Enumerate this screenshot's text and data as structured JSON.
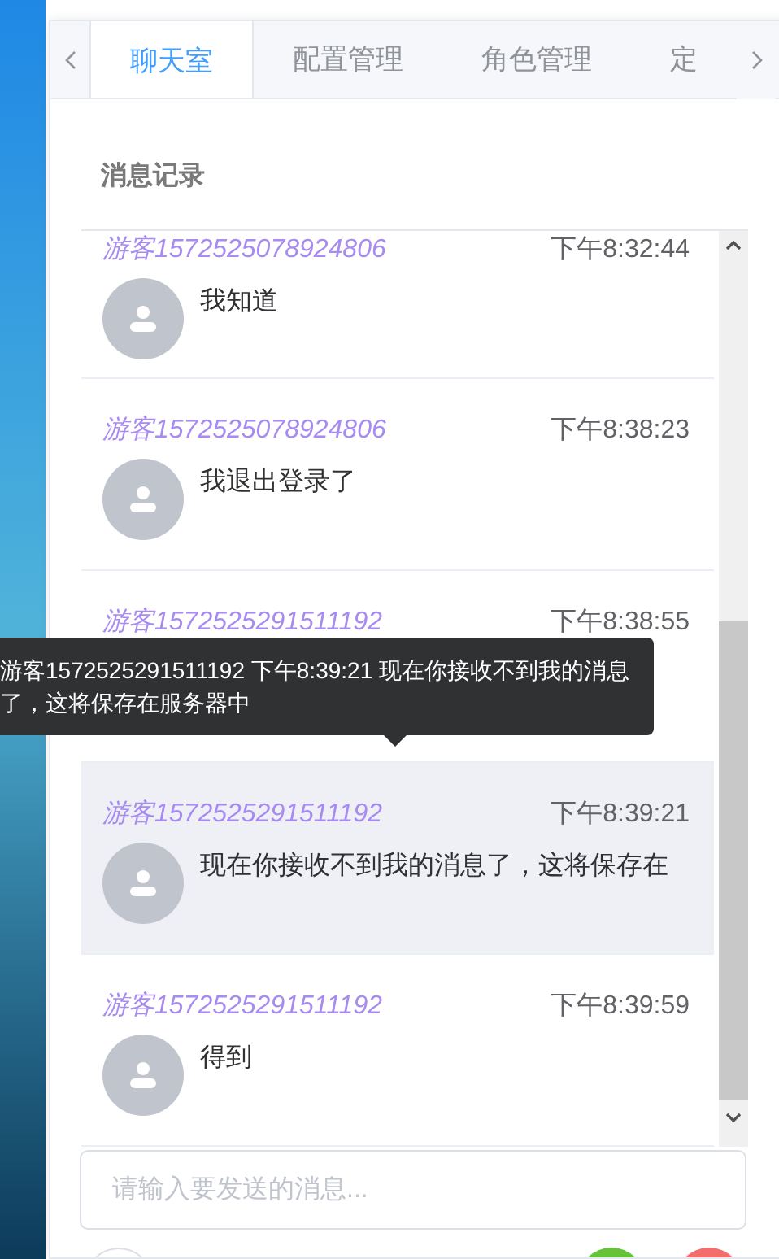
{
  "tabs": [
    {
      "label": "聊天室",
      "selected": true
    },
    {
      "label": "配置管理",
      "selected": false
    },
    {
      "label": "角色管理",
      "selected": false
    },
    {
      "label": "定",
      "selected": false
    }
  ],
  "section_title": "消息记录",
  "messages": [
    {
      "user": "游客1572525078924806",
      "time": "下午8:32:44",
      "text": "我知道",
      "hovered": false
    },
    {
      "user": "游客1572525078924806",
      "time": "下午8:38:23",
      "text": "我退出登录了",
      "hovered": false
    },
    {
      "user": "游客1572525291511192",
      "time": "下午8:38:55",
      "hovered": false
    },
    {
      "user": "游客1572525291511192",
      "time": "下午8:39:21",
      "text": "现在你接收不到我的消息了，这将保存在",
      "hovered": true
    },
    {
      "user": "游客1572525291511192",
      "time": "下午8:39:59",
      "text": "得到",
      "hovered": false
    }
  ],
  "tooltip": "游客1572525291511192 下午8:39:21 现在你接收不到我的消息了，这将保存在服务器中",
  "message_input": {
    "placeholder": "请输入要发送的消息..."
  }
}
